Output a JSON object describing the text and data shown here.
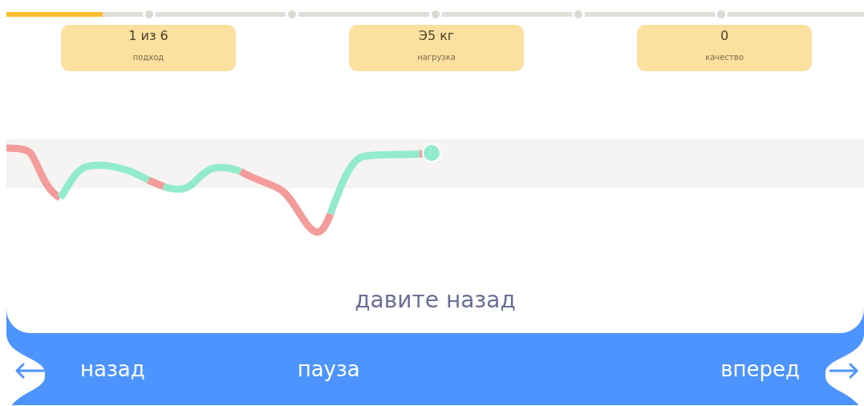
{
  "progress": {
    "level": 0.112
  },
  "stats": [
    {
      "value": "1 из 6",
      "label": "подход"
    },
    {
      "value": "Э5 кг",
      "label": "нагрузка"
    },
    {
      "value": "0",
      "label": "качество"
    }
  ],
  "instruction": "давите назад",
  "buttons": [
    {
      "kind": "back",
      "label": "назад"
    },
    {
      "kind": "pause",
      "label": "пауза"
    },
    {
      "kind": "forward",
      "label": "вперед"
    }
  ]
}
